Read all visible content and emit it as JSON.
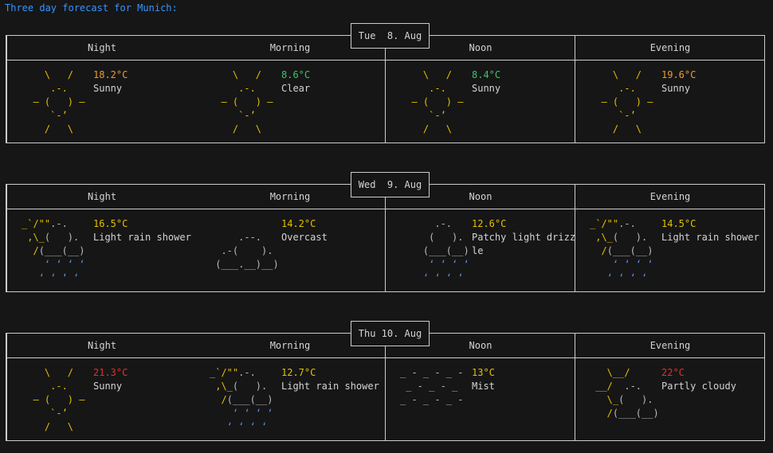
{
  "title": "Three day forecast for Munich:",
  "columns": [
    "Morning",
    "Noon",
    "Evening",
    "Night"
  ],
  "colors": {
    "title": "#3794ff",
    "sun": "#e5c000",
    "cloud": "#bbbbbb",
    "rain": "#5b8ce8",
    "temp_green": "#3ec46d",
    "temp_yellow": "#e5c000",
    "temp_orange": "#f09a2e",
    "temp_red": "#e0322a"
  },
  "days": [
    {
      "date": "Tue  8. Aug",
      "periods": [
        {
          "temp": "8.6°C",
          "temp_color": "#3ec46d",
          "desc": "Clear",
          "icon": "sun-icon"
        },
        {
          "temp": "8.4°C",
          "temp_color": "#3ec46d",
          "desc": "Sunny",
          "icon": "sun-icon"
        },
        {
          "temp": "19.6°C",
          "temp_color": "#f09a2e",
          "desc": "Sunny",
          "icon": "sun-icon"
        },
        {
          "temp": "18.2°C",
          "temp_color": "#f09a2e",
          "desc": "Sunny",
          "icon": "sun-icon"
        }
      ]
    },
    {
      "date": "Wed  9. Aug",
      "periods": [
        {
          "temp": "14.2°C",
          "temp_color": "#e5c000",
          "desc": "Overcast",
          "icon": "overcast-icon"
        },
        {
          "temp": "12.6°C",
          "temp_color": "#e5c000",
          "desc": "Patchy light drizz\nle",
          "icon": "drizzle-icon"
        },
        {
          "temp": "14.5°C",
          "temp_color": "#e5c000",
          "desc": "Light rain shower",
          "icon": "rain-shower-icon"
        },
        {
          "temp": "16.5°C",
          "temp_color": "#e5c000",
          "desc": "Light rain shower",
          "icon": "rain-shower-icon"
        }
      ]
    },
    {
      "date": "Thu 10. Aug",
      "periods": [
        {
          "temp": "12.7°C",
          "temp_color": "#e5c000",
          "desc": "Light rain shower",
          "icon": "rain-shower-icon"
        },
        {
          "temp": "13°C",
          "temp_color": "#e5c000",
          "desc": "Mist",
          "icon": "mist-icon"
        },
        {
          "temp": "22°C",
          "temp_color": "#e0322a",
          "desc": "Partly cloudy",
          "icon": "partly-cloudy-icon"
        },
        {
          "temp": "21.3°C",
          "temp_color": "#e0322a",
          "desc": "Sunny",
          "icon": "sun-icon"
        }
      ]
    }
  ]
}
